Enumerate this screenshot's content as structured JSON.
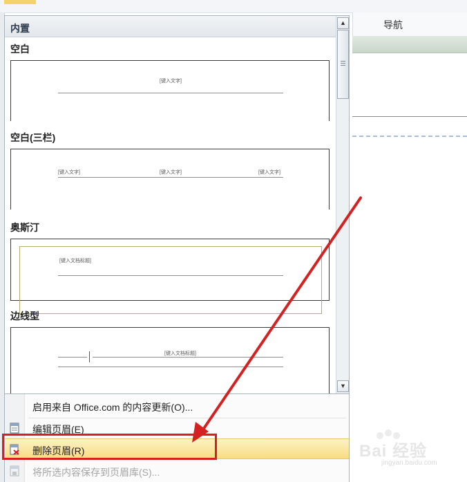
{
  "gallery": {
    "header": "内置",
    "categories": [
      {
        "label": "空白",
        "placeholders": [
          "[键入文字]"
        ]
      },
      {
        "label": "空白(三栏)",
        "placeholders": [
          "[键入文字]",
          "[键入文字]",
          "[键入文字]"
        ]
      },
      {
        "label": "奥斯汀",
        "placeholders": [
          "[键入文档标题]"
        ]
      },
      {
        "label": "边线型",
        "placeholders": [
          "[键入文档标题]"
        ]
      }
    ]
  },
  "scrollbar": {
    "up": "▲",
    "down": "▼",
    "grip": "≡"
  },
  "menu": {
    "items": [
      {
        "label": "启用来自 Office.com 的内容更新(O)...",
        "icon": "none"
      },
      {
        "label": "编辑页眉(E)",
        "icon": "edit-header-icon"
      },
      {
        "label": "删除页眉(R)",
        "icon": "delete-header-icon",
        "highlighted": true
      },
      {
        "label": "将所选内容保存到页眉库(S)...",
        "icon": "save-to-gallery-icon",
        "disabled": true
      }
    ]
  },
  "navigation": {
    "title": "导航"
  },
  "watermark": {
    "text": "Bai 经验",
    "url": "jingyan.baidu.com"
  },
  "colors": {
    "highlight": "#f8dc82",
    "annotation": "#d81e1e",
    "accent_tab": "#f4d46a"
  }
}
